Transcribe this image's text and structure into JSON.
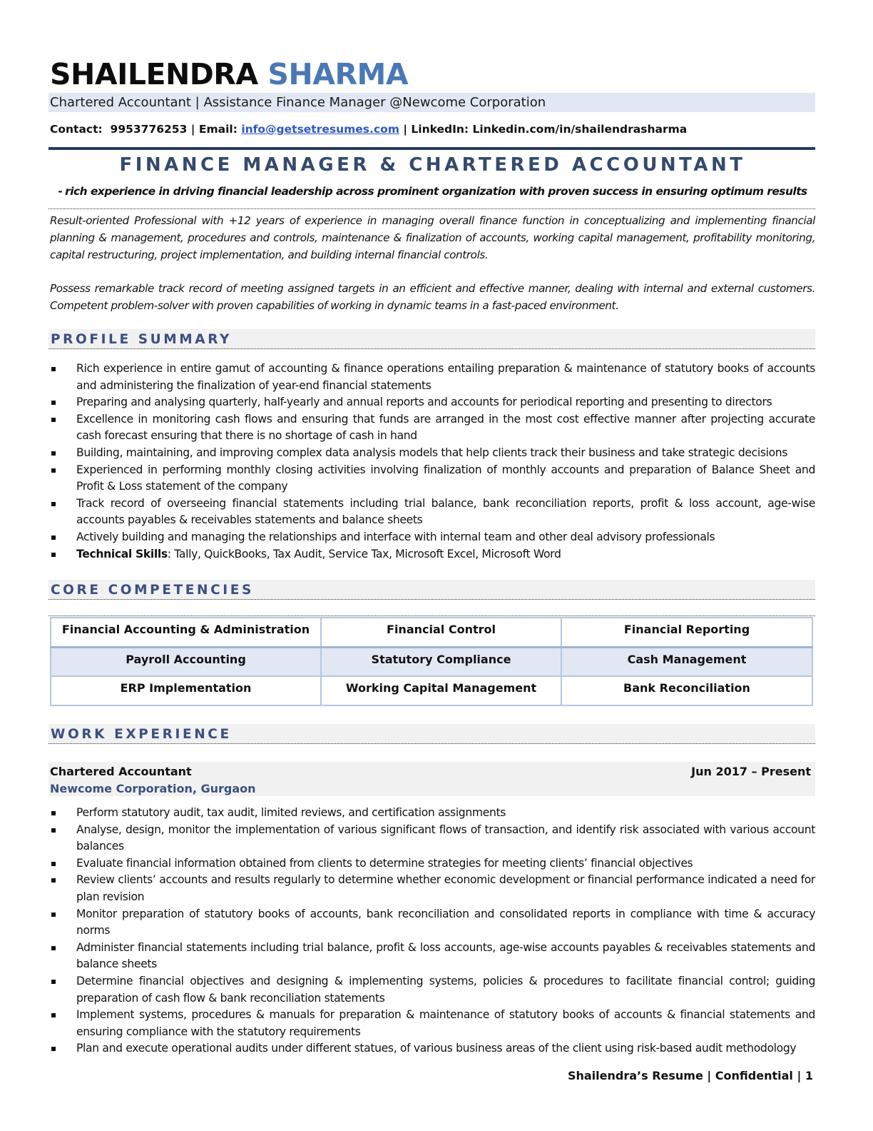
{
  "header": {
    "first_name": "SHAILENDRA",
    "last_name": "SHARMA",
    "subtitle": "Chartered Accountant | Assistance Finance Manager @Newcome Corporation",
    "contact_label": "Contact:",
    "phone": "9953776253",
    "separator": "|",
    "email_label": "Email:",
    "email": "info@getsetresumes.com",
    "linkedin_label": "LinkedIn:",
    "linkedin": "Linkedin.com/in/shailendrasharma"
  },
  "headline": {
    "title": "FINANCE MANAGER & CHARTERED ACCOUNTANT",
    "tagline_dash": "-",
    "tagline": "rich experience in driving financial leadership across prominent organization with proven success in ensuring optimum results"
  },
  "intro": {
    "paragraphs": [
      "Result-oriented Professional with +12 years of experience in managing overall finance function in conceptualizing and implementing financial planning & management, procedures and controls, maintenance & finalization of accounts, working capital management, profitability monitoring, capital restructuring, project implementation, and building internal financial controls.",
      "Possess remarkable track record of meeting assigned targets in an efficient and effective manner, dealing with internal and external customers. Competent problem-solver with proven capabilities of working in dynamic teams in a fast-paced environment."
    ]
  },
  "profile_summary": {
    "title": "PROFILE SUMMARY",
    "items": [
      "Rich experience in entire gamut of accounting & finance operations entailing preparation & maintenance of statutory books of accounts and administering the finalization of year-end financial statements",
      "Preparing and analysing quarterly, half-yearly and annual reports and accounts for periodical reporting and presenting to directors",
      "Excellence in monitoring cash flows and ensuring that funds are arranged in the most cost effective manner after projecting accurate cash forecast ensuring that there is no shortage of cash in hand",
      "Building, maintaining, and improving complex data analysis models that help clients track their business and take strategic decisions",
      "Experienced in performing monthly closing activities involving finalization of monthly accounts and preparation of Balance Sheet and Profit & Loss statement of the company",
      "Track record of overseeing financial statements including trial balance, bank reconciliation reports, profit & loss account, age-wise accounts payables & receivables statements and balance sheets",
      "Actively building and managing the relationships and interface with internal team and other deal advisory professionals"
    ],
    "skills_label": "Technical Skills",
    "skills_value": ": Tally, QuickBooks, Tax Audit, Service Tax, Microsoft Excel, Microsoft Word"
  },
  "core_competencies": {
    "title": "CORE COMPETENCIES",
    "rows": [
      [
        "Financial Accounting & Administration",
        "Financial Control",
        "Financial Reporting"
      ],
      [
        "Payroll Accounting",
        "Statutory Compliance",
        "Cash Management"
      ],
      [
        "ERP Implementation",
        "Working Capital Management",
        "Bank Reconciliation"
      ]
    ]
  },
  "work_experience": {
    "title": "WORK EXPERIENCE",
    "jobs": [
      {
        "title": "Chartered Accountant",
        "company": "Newcome Corporation, Gurgaon",
        "dates": "Jun 2017 – Present",
        "bullets": [
          "Perform statutory audit, tax audit, limited reviews, and certification assignments",
          "Analyse, design, monitor the implementation of various significant flows of transaction, and identify risk associated with various account balances",
          "Evaluate financial information obtained from clients to determine strategies for meeting clients’ financial objectives",
          "Review clients’ accounts and results regularly to determine whether economic development or financial performance indicated a need for plan revision",
          "Monitor preparation of statutory books of accounts, bank reconciliation and consolidated reports in compliance with time & accuracy norms",
          "Administer financial statements including trial balance, profit & loss accounts, age-wise accounts payables & receivables statements and balance sheets",
          "Determine financial objectives and designing & implementing systems, policies & procedures to facilitate financial control; guiding preparation of cash flow & bank reconciliation statements",
          "Implement systems, procedures & manuals for preparation & maintenance of statutory books of accounts & financial statements and ensuring compliance with the statutory requirements",
          "Plan and execute operational audits under different statues, of various business areas of the client using risk-based audit methodology"
        ]
      }
    ]
  },
  "footer": {
    "text": "Shailendra’s Resume | Confidential | 1"
  }
}
